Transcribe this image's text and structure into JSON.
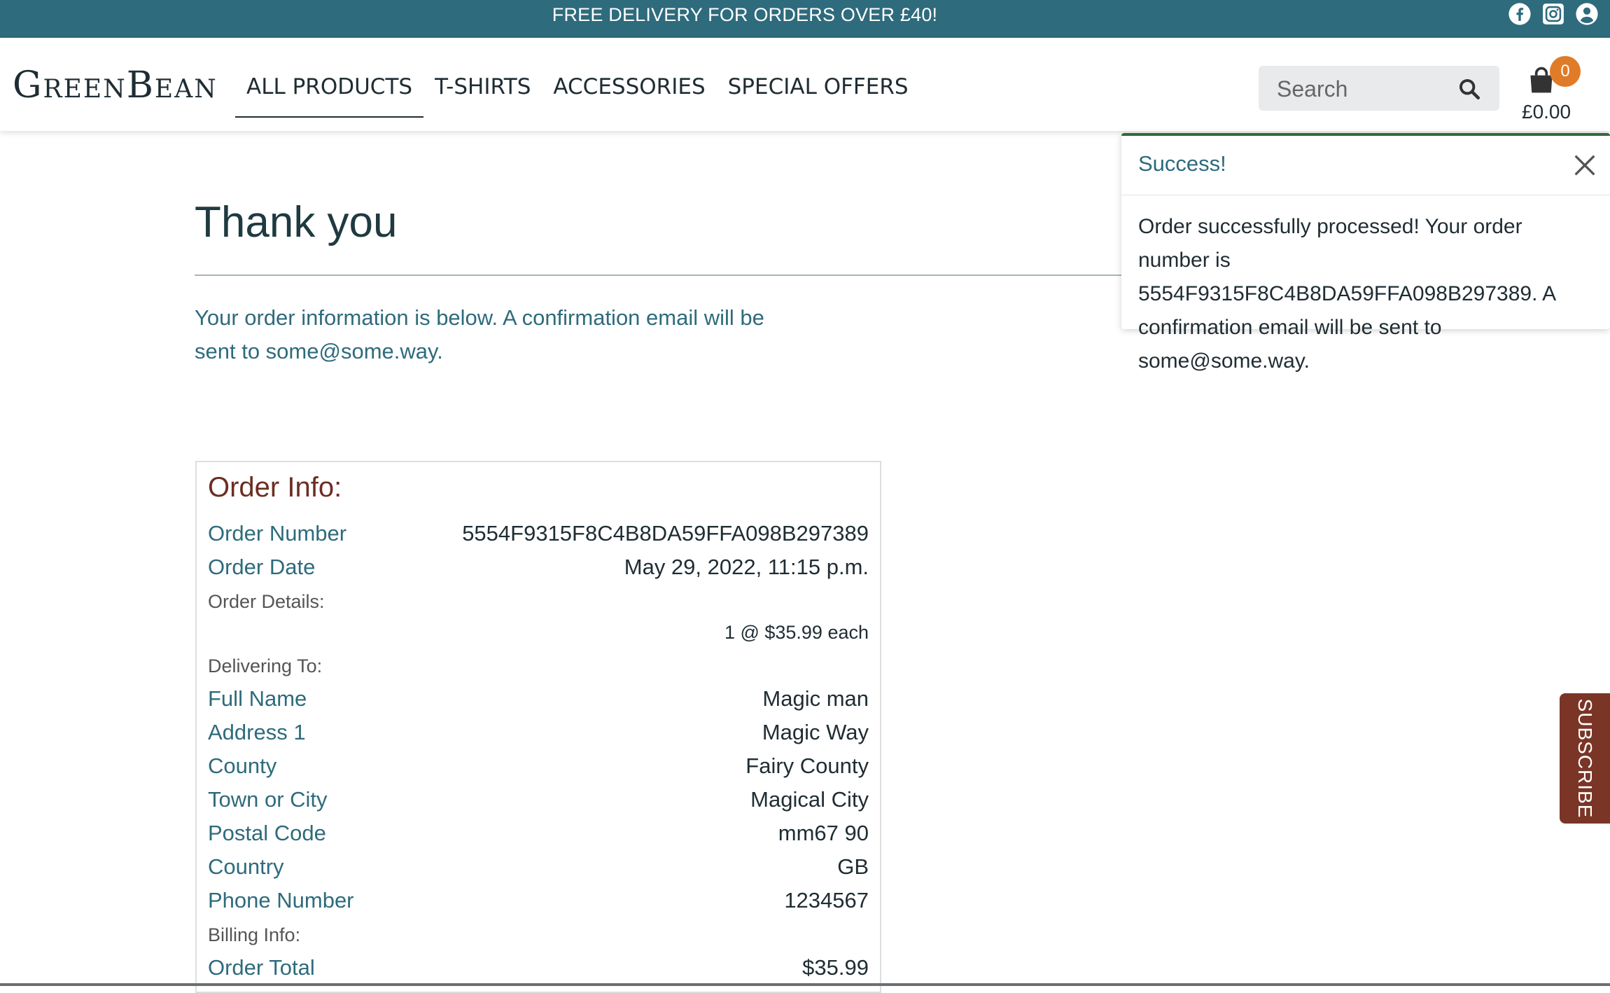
{
  "banner": {
    "text": "FREE DELIVERY FOR ORDERS OVER £40!",
    "icons": [
      "facebook-icon",
      "instagram-icon",
      "account-icon"
    ]
  },
  "header": {
    "logo": "GreenBean",
    "nav": [
      "All Products",
      "T-Shirts",
      "Accessories",
      "Special Offers"
    ],
    "search_placeholder": "Search",
    "cart_count": "0",
    "cart_total": "£0.00"
  },
  "main": {
    "title": "Thank you",
    "intro": "Your order information is below. A confirmation email will be sent to some@some.way."
  },
  "order": {
    "title": "Order Info:",
    "number_label": "Order Number",
    "number": "5554F9315F8C4B8DA59FFA098B297389",
    "date_label": "Order Date",
    "date": "May 29, 2022, 11:15 p.m.",
    "details_label": "Order Details:",
    "line_item": "1 @ $35.99 each",
    "delivering_label": "Delivering To:",
    "delivery": [
      {
        "label": "Full Name",
        "value": "Magic man"
      },
      {
        "label": "Address 1",
        "value": "Magic Way"
      },
      {
        "label": "County",
        "value": "Fairy County"
      },
      {
        "label": "Town or City",
        "value": "Magical City"
      },
      {
        "label": "Postal Code",
        "value": "mm67 90"
      },
      {
        "label": "Country",
        "value": "GB"
      },
      {
        "label": "Phone Number",
        "value": "1234567"
      }
    ],
    "billing_label": "Billing Info:",
    "total_label": "Order Total",
    "total": "$35.99"
  },
  "toast": {
    "title": "Success!",
    "message": "Order successfully processed! Your order number is 5554F9315F8C4B8DA59FFA098B297389. A confirmation email will be sent to some@some.way."
  },
  "subscribe": {
    "label": "Subscribe"
  },
  "colors": {
    "banner": "#2e6b7c",
    "accent": "#2e6b7c",
    "order_title": "#6e2d22",
    "badge": "#e07b28",
    "toast_border": "#2f6b3a",
    "subscribe": "#7a3526"
  }
}
